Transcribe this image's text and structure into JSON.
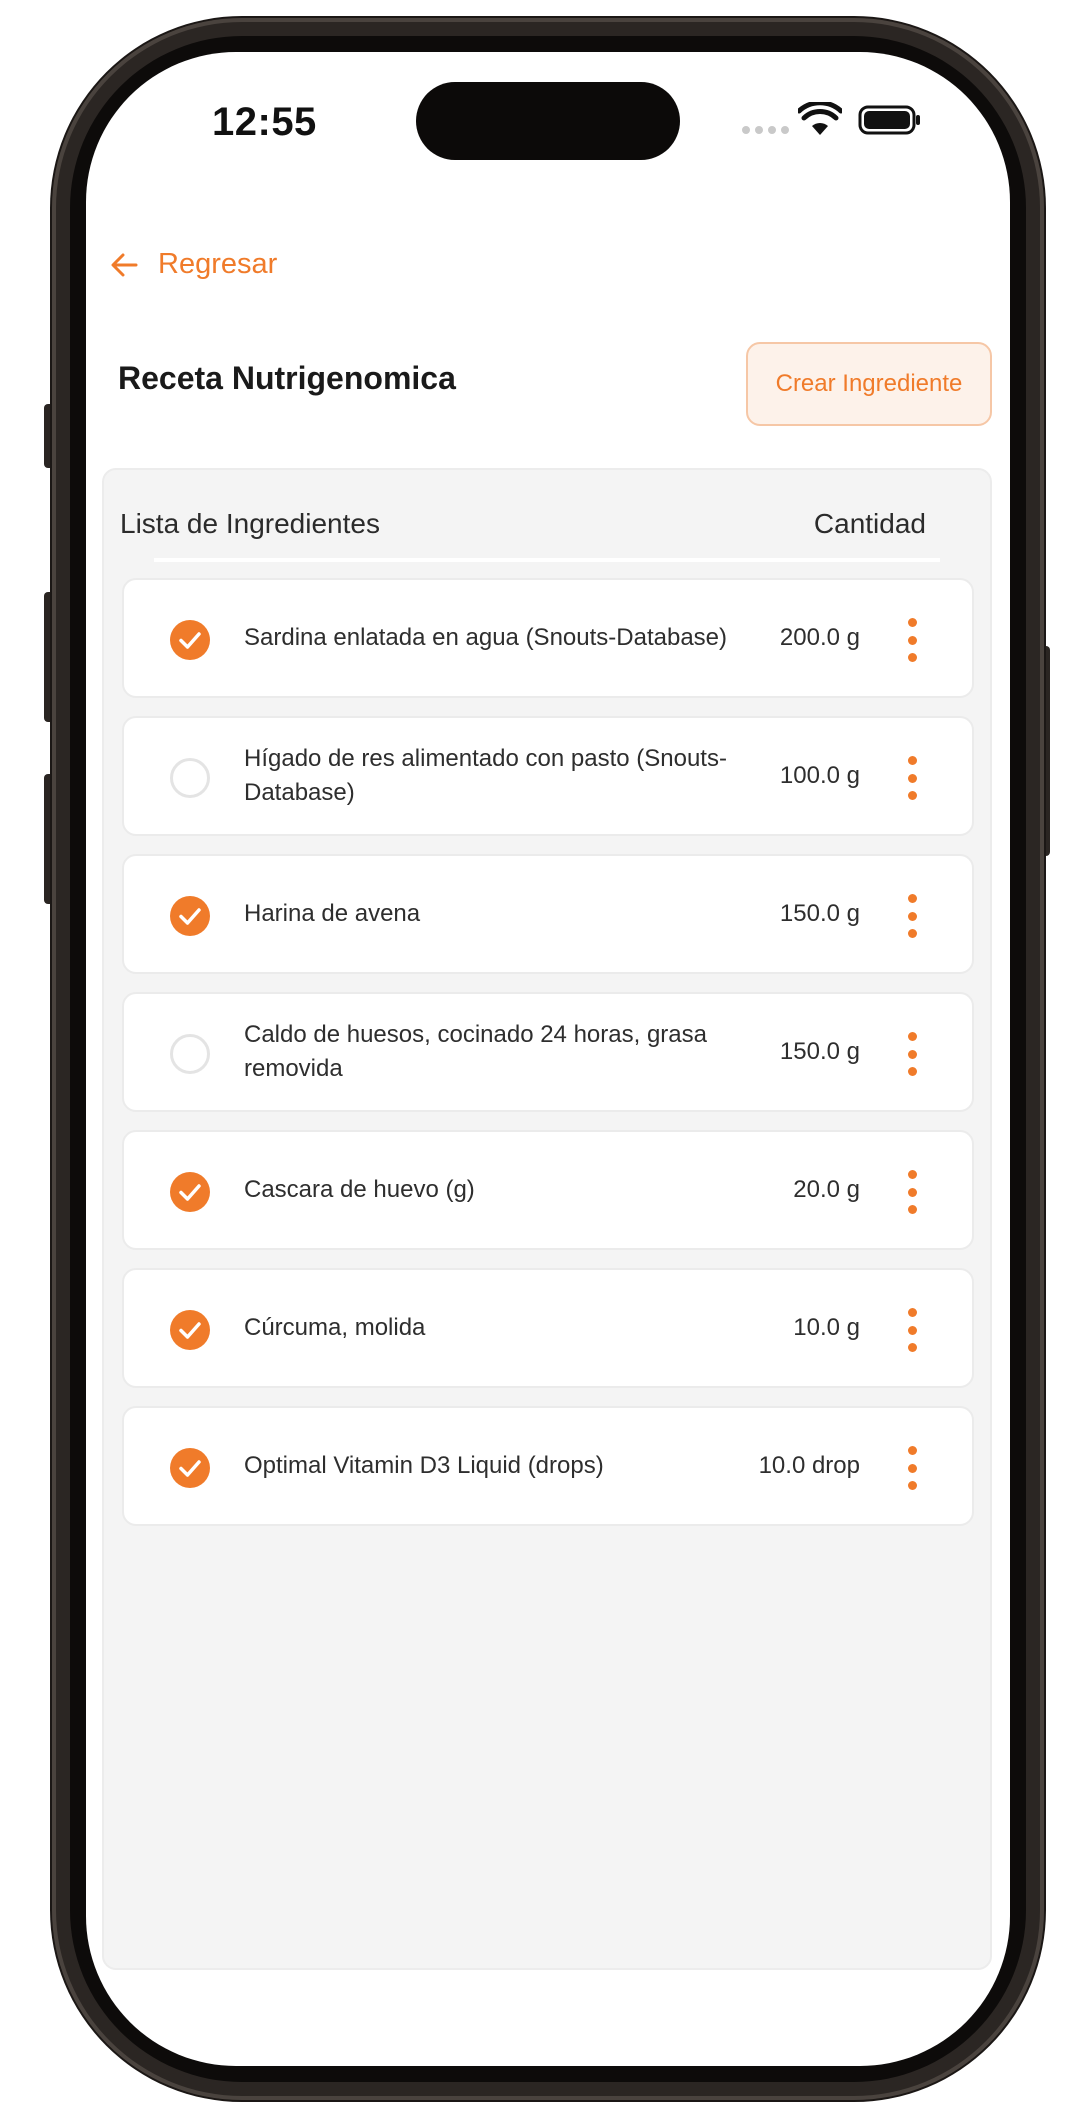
{
  "status_bar": {
    "time": "12:55",
    "icons": [
      "cellular-signal-icon",
      "wifi-icon",
      "battery-icon"
    ]
  },
  "nav": {
    "back_label": "Regresar",
    "back_icon": "arrow-left-icon"
  },
  "header": {
    "title": "Receta Nutrigenomica",
    "create_button_label": "Crear Ingrediente"
  },
  "list": {
    "column_ingredients": "Lista de Ingredientes",
    "column_quantity": "Cantidad",
    "items": [
      {
        "name": "Sardina enlatada en agua (Snouts-Database)",
        "quantity": "200.0 g",
        "checked": true
      },
      {
        "name": "Hígado de res alimentado con pasto (Snouts-Database)",
        "quantity": "100.0 g",
        "checked": false
      },
      {
        "name": "Harina de avena",
        "quantity": "150.0 g",
        "checked": true
      },
      {
        "name": "Caldo de huesos, cocinado 24 horas, grasa removida",
        "quantity": "150.0 g",
        "checked": false
      },
      {
        "name": "Cascara de huevo (g)",
        "quantity": "20.0 g",
        "checked": true
      },
      {
        "name": "Cúrcuma, molida",
        "quantity": "10.0 g",
        "checked": true
      },
      {
        "name": "Optimal Vitamin D3 Liquid (drops)",
        "quantity": "10.0 drop",
        "checked": true
      }
    ]
  },
  "colors": {
    "accent": "#f07b2a",
    "accent_soft": "#fdf2ea",
    "panel_bg": "#f4f4f4",
    "frame": "#2b2623"
  }
}
